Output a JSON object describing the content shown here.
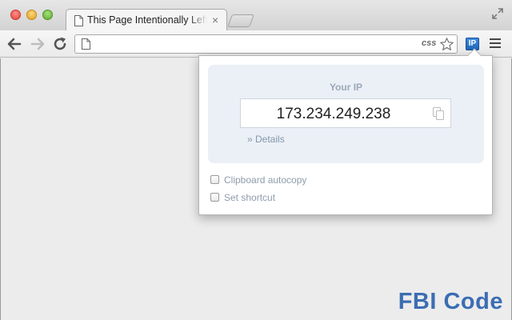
{
  "window": {
    "tab_title": "This Page Intentionally Left Blank",
    "tab_close_glyph": "×"
  },
  "toolbar": {
    "url_value": "",
    "omnibox_badge": "css",
    "extension_label": "IP"
  },
  "popup": {
    "heading": "Your IP",
    "ip_address": "173.234.249.238",
    "details_label": "» Details",
    "options": [
      {
        "label": "Clipboard autocopy",
        "checked": false
      },
      {
        "label": "Set shortcut",
        "checked": false
      }
    ]
  },
  "watermark": "FBI Code",
  "colors": {
    "panel_bg": "#ebf0f7",
    "extension_blue": "#1f65b8",
    "watermark": "#3b6db3"
  },
  "icons": [
    "page-icon",
    "back-arrow-icon",
    "forward-arrow-icon",
    "reload-icon",
    "star-icon",
    "copy-icon",
    "menu-icon",
    "fullscreen-icon"
  ]
}
